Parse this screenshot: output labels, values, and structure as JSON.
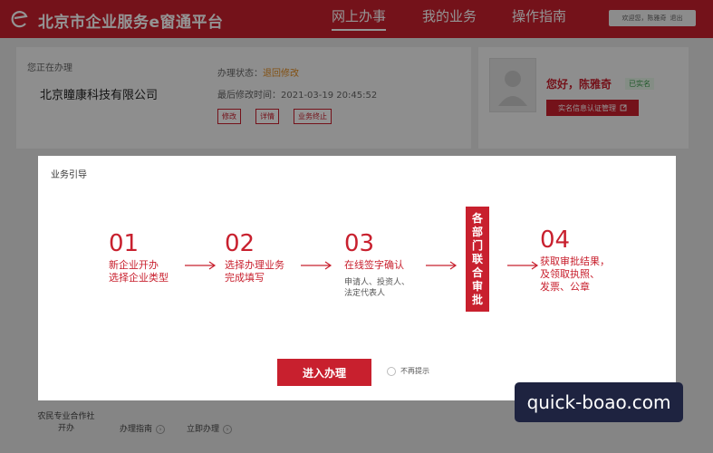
{
  "header": {
    "app_title": "北京市企业服务e窗通平台",
    "nav": [
      "网上办事",
      "我的业务",
      "操作指南"
    ],
    "active_nav": "网上办事",
    "user_greeting": "欢迎您，陈雅奇",
    "logout": "退出"
  },
  "current_task": {
    "heading": "您正在办理",
    "company": "北京瞳康科技有限公司",
    "status_label": "办理状态：",
    "status_value": "退回修改",
    "modified_label": "最后修改时间：",
    "modified_value": "2021-03-19 20:45:52",
    "buttons": [
      "修改",
      "详情",
      "业务终止"
    ]
  },
  "profile": {
    "greeting": "您好，陈雅奇",
    "verified": "已实名",
    "verify_button": "实名信息认证管理"
  },
  "bottom": {
    "item_name": "农民专业合作社开办",
    "guide": "办理指南",
    "immediate": "立即办理"
  },
  "modal": {
    "title": "业务引导",
    "steps": [
      {
        "num": "01",
        "text": [
          "新企业开办",
          "选择企业类型"
        ],
        "sub": []
      },
      {
        "num": "02",
        "text": [
          "选择办理业务",
          "完成填写"
        ],
        "sub": []
      },
      {
        "num": "03",
        "text": [
          "在线签字确认"
        ],
        "sub": [
          "申请人、投资人、",
          "法定代表人"
        ]
      },
      {
        "num": "04",
        "text": [
          "获取审批结果，",
          "及领取执照、",
          "发票、公章"
        ],
        "sub": []
      }
    ],
    "dept_chars": [
      "各",
      "部",
      "门",
      "联",
      "合",
      "审",
      "批"
    ],
    "enter_button": "进入办理",
    "no_remind": "不再提示"
  },
  "watermark": "quick-boao.com",
  "colors": {
    "brand_red": "#c8202e",
    "status_orange": "#e08a1e"
  }
}
